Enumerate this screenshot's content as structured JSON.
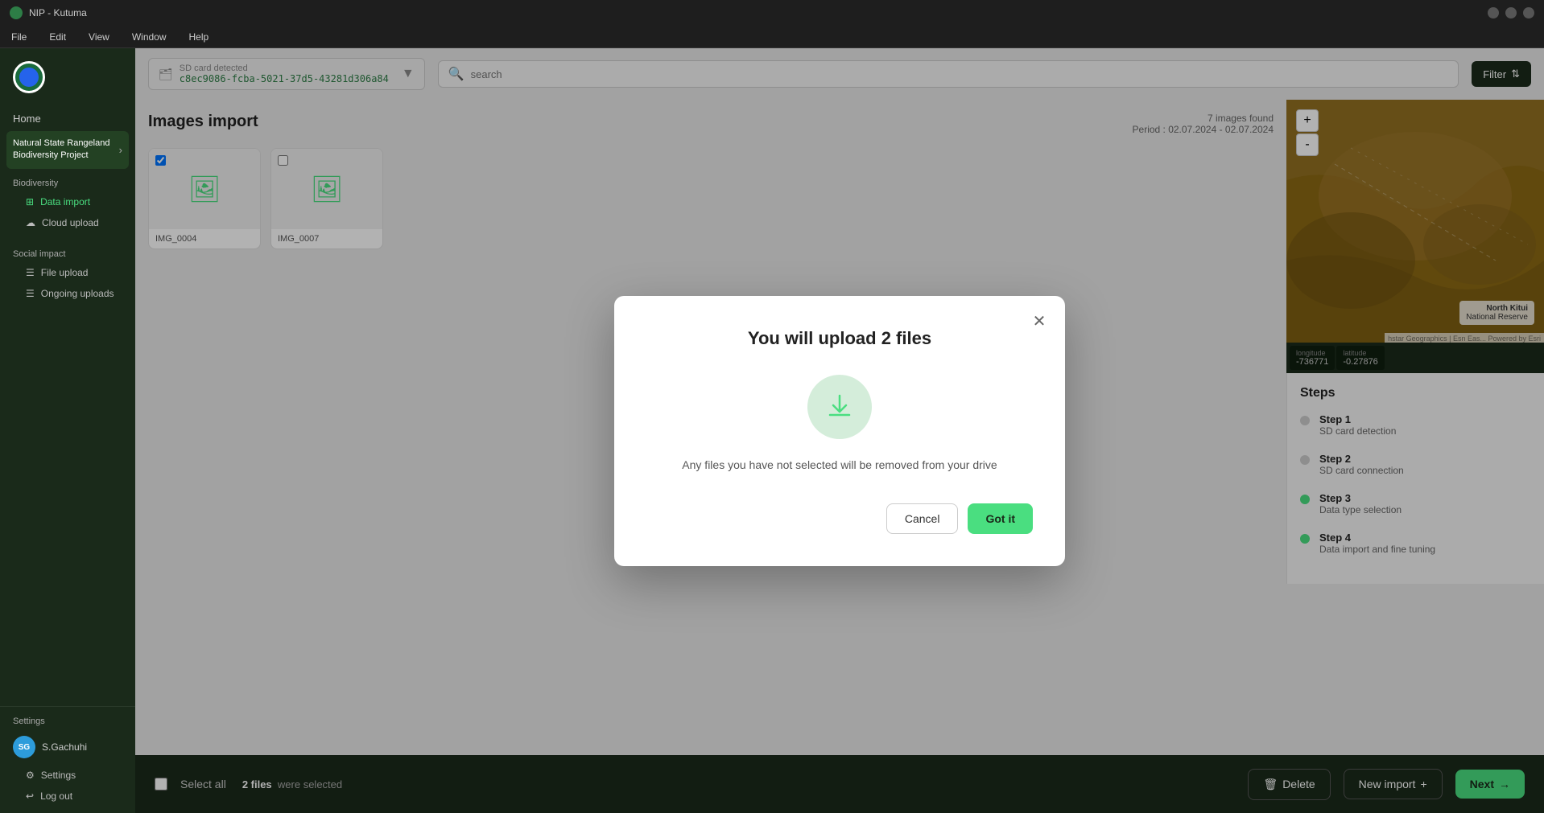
{
  "app": {
    "title": "NIP - Kutuma"
  },
  "titlebar": {
    "title": "NIP - Kutuma"
  },
  "menubar": {
    "items": [
      "File",
      "Edit",
      "View",
      "Window",
      "Help"
    ]
  },
  "sidebar": {
    "logo_initials": "",
    "home_label": "Home",
    "project_name": "Natural State Rangeland Biodiversity Project",
    "sections": [
      {
        "label": "Biodiversity",
        "items": [
          {
            "id": "data-import",
            "label": "Data import",
            "active": true
          },
          {
            "id": "cloud-upload",
            "label": "Cloud upload",
            "active": false
          }
        ]
      },
      {
        "label": "Social impact",
        "items": [
          {
            "id": "file-upload",
            "label": "File upload",
            "active": false
          },
          {
            "id": "ongoing-uploads",
            "label": "Ongoing uploads",
            "active": false
          }
        ]
      }
    ],
    "settings_label": "Settings",
    "user_name": "S.Gachuhi",
    "user_initials": "SG",
    "settings_item": "Settings",
    "logout_label": "Log out"
  },
  "topbar": {
    "sd_label": "SD card detected",
    "sd_id": "c8ec9086-fcba-5021-37d5-43281d306a84",
    "search_placeholder": "search",
    "filter_label": "Filter"
  },
  "images_panel": {
    "title": "Images import",
    "images_count": "7 images found",
    "period": "Period : 02.07.2024 - 02.07.2024",
    "images": [
      {
        "id": "img1",
        "label": "IMG_0004",
        "checked": true
      },
      {
        "id": "img2",
        "label": "IMG_0007",
        "checked": false
      }
    ]
  },
  "map": {
    "zoom_in": "+",
    "zoom_out": "-",
    "location_name": "North Kitui\nNational Reserve",
    "attribution": "hstar Geographics | Esn Eas... Powered by Esri",
    "longitude_label": "longitude",
    "longitude_value": "-736771",
    "latitude_label": "latitude",
    "latitude_value": "-0.27876"
  },
  "steps": {
    "title": "Steps",
    "items": [
      {
        "id": "step1",
        "name": "Step 1",
        "desc": "SD card detection",
        "active": false
      },
      {
        "id": "step2",
        "name": "Step 2",
        "desc": "SD card connection",
        "active": false
      },
      {
        "id": "step3",
        "name": "Step 3",
        "desc": "Data type selection",
        "active": true
      },
      {
        "id": "step4",
        "name": "Step 4",
        "desc": "Data import and fine tuning",
        "active": true
      }
    ]
  },
  "bottom_bar": {
    "select_all_label": "Select all",
    "files_selected_count": "2 files",
    "files_selected_suffix": "were selected",
    "delete_label": "Delete",
    "new_import_label": "New import",
    "next_label": "Next"
  },
  "modal": {
    "title": "You will upload 2 files",
    "message": "Any files you have not selected will be removed from your drive",
    "cancel_label": "Cancel",
    "got_it_label": "Got it"
  }
}
